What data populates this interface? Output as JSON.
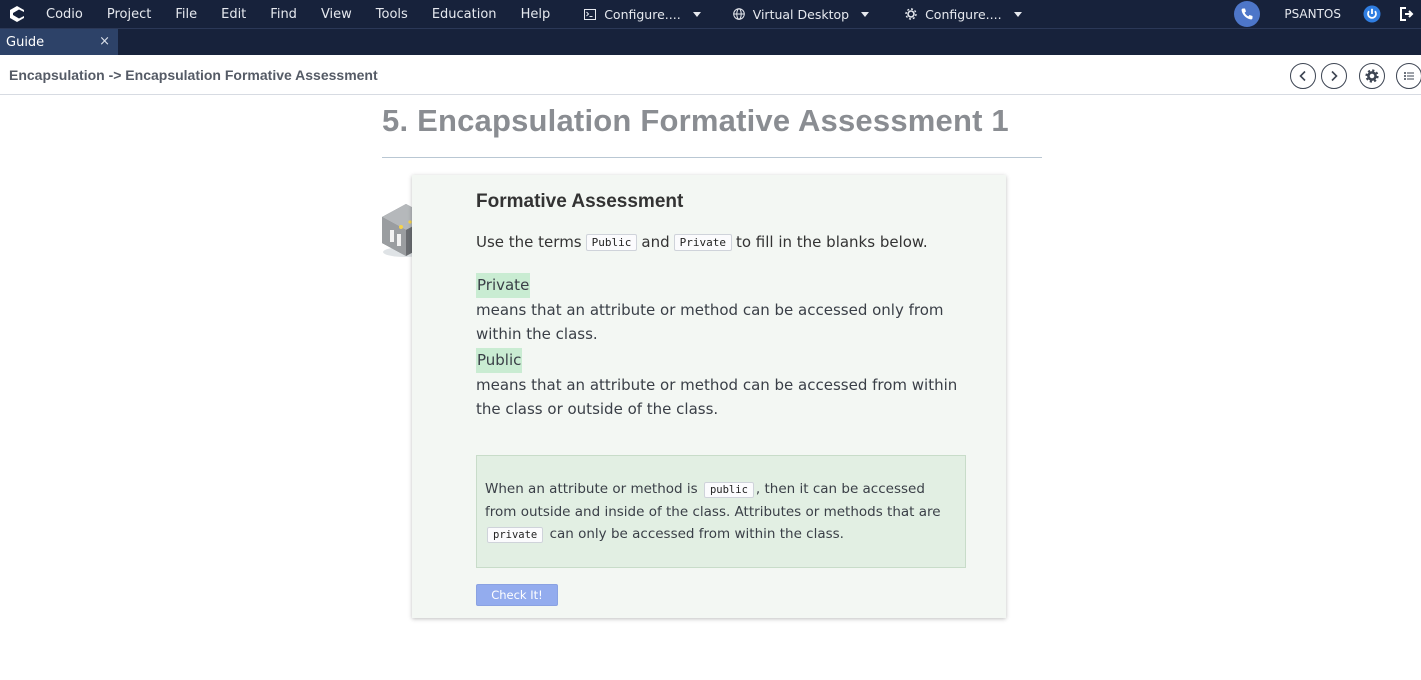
{
  "menubar": {
    "items": [
      "Codio",
      "Project",
      "File",
      "Edit",
      "Find",
      "View",
      "Tools",
      "Education",
      "Help"
    ],
    "dropdowns": [
      {
        "label": "Configure....",
        "icon": "terminal-icon"
      },
      {
        "label": "Virtual Desktop",
        "icon": "globe-icon"
      },
      {
        "label": "Configure....",
        "icon": "gear-icon"
      }
    ],
    "username": "PSANTOS"
  },
  "tabs": [
    {
      "label": "Guide",
      "close": "×"
    }
  ],
  "breadcrumb": "Encapsulation -> Encapsulation Formative Assessment",
  "page": {
    "title": "5. Encapsulation Formative Assessment 1",
    "card_title": "Formative Assessment",
    "instruction": {
      "prefix": "Use the terms",
      "term1": "Public",
      "middle": "and",
      "term2": "Private",
      "suffix": "to fill in the blanks below."
    },
    "blanks": [
      {
        "answer": "Private",
        "sentence": " means that an attribute or method can be accessed only from within the class."
      },
      {
        "answer": "Public",
        "sentence": " means that an attribute or method can be accessed from within the class or outside of the class."
      }
    ],
    "explanation": {
      "part1": "When an attribute or method is",
      "code1": "public",
      "part2": ", then it can be accessed from outside and inside of the class. Attributes or methods that are",
      "code2": "private",
      "part3": "can only be accessed from within the class."
    },
    "check_button": "Check It!"
  },
  "colors": {
    "menubar_bg": "#17223b",
    "tab_active_bg": "#2d4268",
    "blank_fill": "#c9ecd2",
    "card_bg": "#f3f7f3",
    "explain_bg": "#e2efe3",
    "button_bg": "#93acee"
  }
}
